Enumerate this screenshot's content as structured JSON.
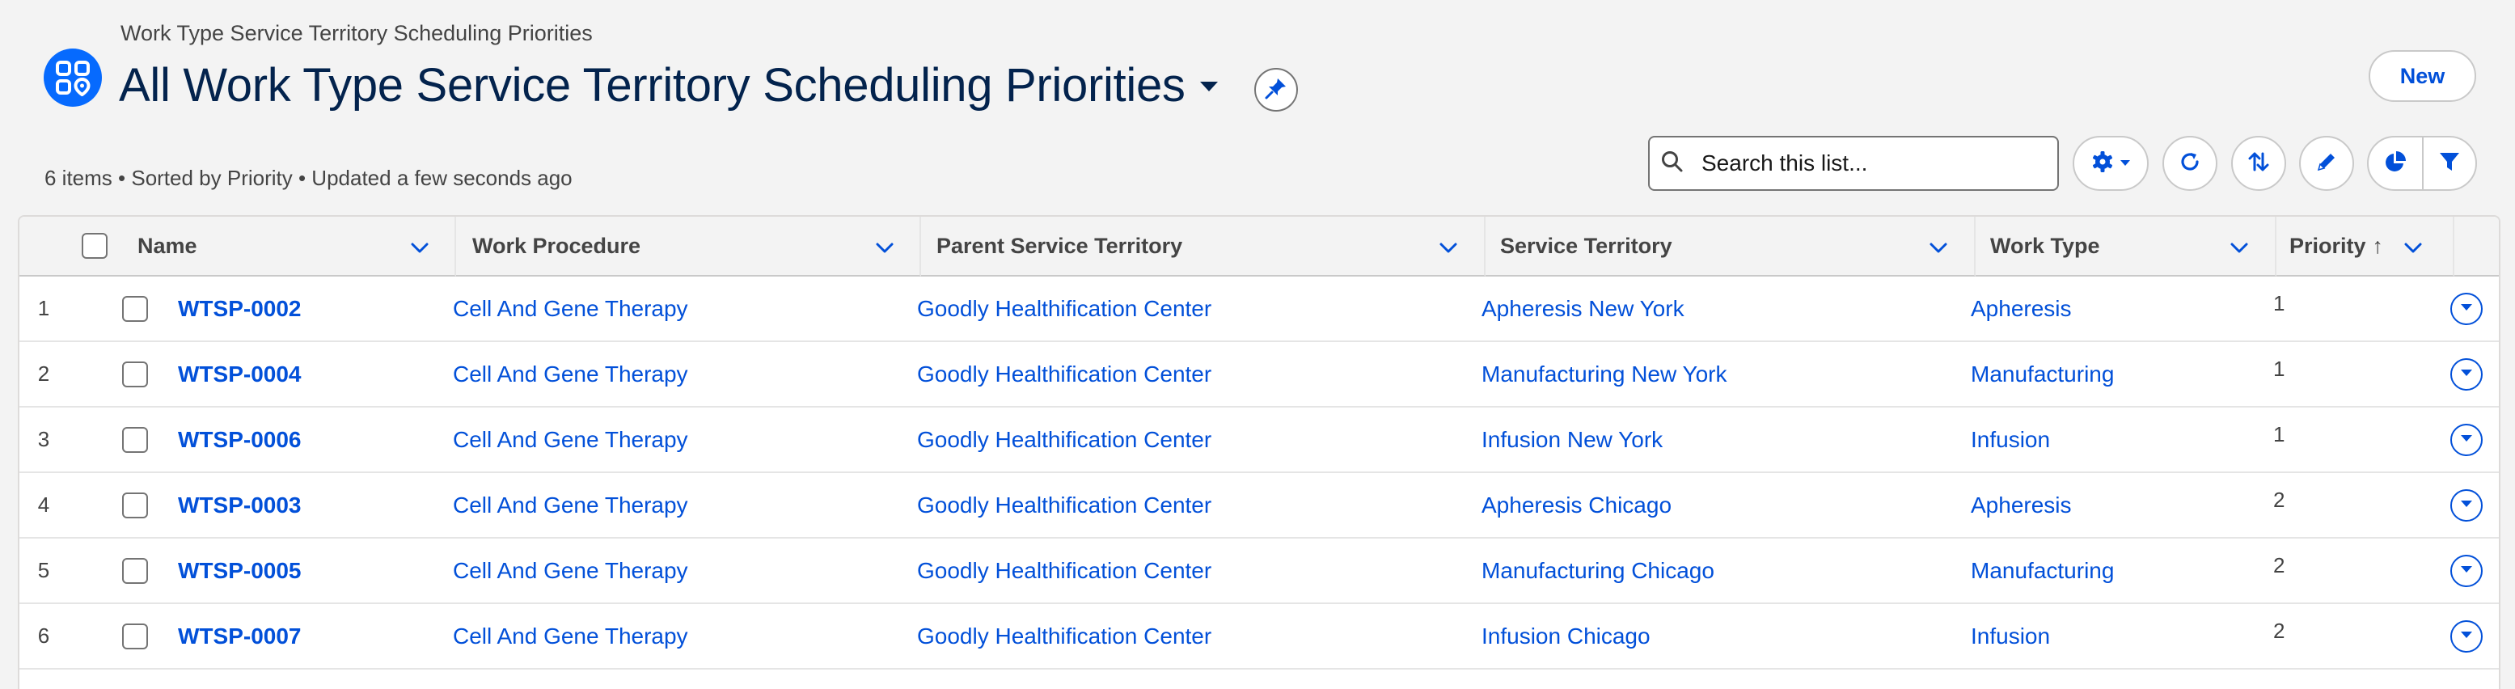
{
  "header": {
    "object_label": "Work Type Service Territory Scheduling Priorities",
    "list_title": "All Work Type Service Territory Scheduling Priorities",
    "new_button": "New",
    "meta": "6 items • Sorted by Priority • Updated a few seconds ago"
  },
  "search": {
    "placeholder": "Search this list..."
  },
  "table": {
    "columns": [
      "Name",
      "Work Procedure",
      "Parent Service Territory",
      "Service Territory",
      "Work Type",
      "Priority"
    ],
    "sort_indicator": "↑",
    "rows": [
      {
        "num": "1",
        "name": "WTSP-0002",
        "procedure": "Cell And Gene Therapy",
        "parent": "Goodly Healthification Center",
        "territory": "Apheresis New York",
        "work_type": "Apheresis",
        "priority": "1"
      },
      {
        "num": "2",
        "name": "WTSP-0004",
        "procedure": "Cell And Gene Therapy",
        "parent": "Goodly Healthification Center",
        "territory": "Manufacturing New York",
        "work_type": "Manufacturing",
        "priority": "1"
      },
      {
        "num": "3",
        "name": "WTSP-0006",
        "procedure": "Cell And Gene Therapy",
        "parent": "Goodly Healthification Center",
        "territory": "Infusion New York",
        "work_type": "Infusion",
        "priority": "1"
      },
      {
        "num": "4",
        "name": "WTSP-0003",
        "procedure": "Cell And Gene Therapy",
        "parent": "Goodly Healthification Center",
        "territory": "Apheresis Chicago",
        "work_type": "Apheresis",
        "priority": "2"
      },
      {
        "num": "5",
        "name": "WTSP-0005",
        "procedure": "Cell And Gene Therapy",
        "parent": "Goodly Healthification Center",
        "territory": "Manufacturing Chicago",
        "work_type": "Manufacturing",
        "priority": "2"
      },
      {
        "num": "6",
        "name": "WTSP-0007",
        "procedure": "Cell And Gene Therapy",
        "parent": "Goodly Healthification Center",
        "territory": "Infusion Chicago",
        "work_type": "Infusion",
        "priority": "2"
      }
    ]
  },
  "icons": {
    "app": "apps-grid-icon",
    "title_caret": "caret-down-icon",
    "pin": "pin-icon",
    "search": "search-icon",
    "settings": "gear-icon",
    "refresh": "refresh-icon",
    "sort": "sort-icon",
    "edit": "pencil-icon",
    "chart": "pie-chart-icon",
    "filter": "filter-icon",
    "row_action": "chevron-down-circle-icon"
  },
  "colors": {
    "brand": "#066afe",
    "link": "#0250d9",
    "title": "#03234d",
    "background": "#f3f3f3"
  }
}
